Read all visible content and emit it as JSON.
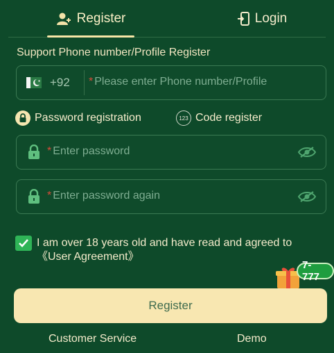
{
  "tabs": {
    "register_label": "Register",
    "login_label": "Login",
    "active": "register"
  },
  "subtitle": "Support Phone number/Profile Register",
  "phone": {
    "country_code": "+92",
    "required_mark": "*",
    "placeholder": "Please enter Phone number/Profile"
  },
  "modes": {
    "password_label": "Password registration",
    "code_label": "Code register",
    "code_icon_text": "123"
  },
  "password": {
    "required_mark": "*",
    "placeholder": "Enter password"
  },
  "password_again": {
    "required_mark": "*",
    "placeholder": "Enter password again"
  },
  "agreement": {
    "checked": true,
    "text": "I am over 18 years old and have read and agreed to 《User Agreement》"
  },
  "promo_badge": "7-777",
  "register_button": "Register",
  "footer": {
    "customer_service": "Customer Service",
    "demo": "Demo"
  },
  "colors": {
    "background": "#0e4a2a",
    "accent": "#f8e7b1",
    "checkbox": "#2fb457",
    "required": "#d94b3a"
  }
}
